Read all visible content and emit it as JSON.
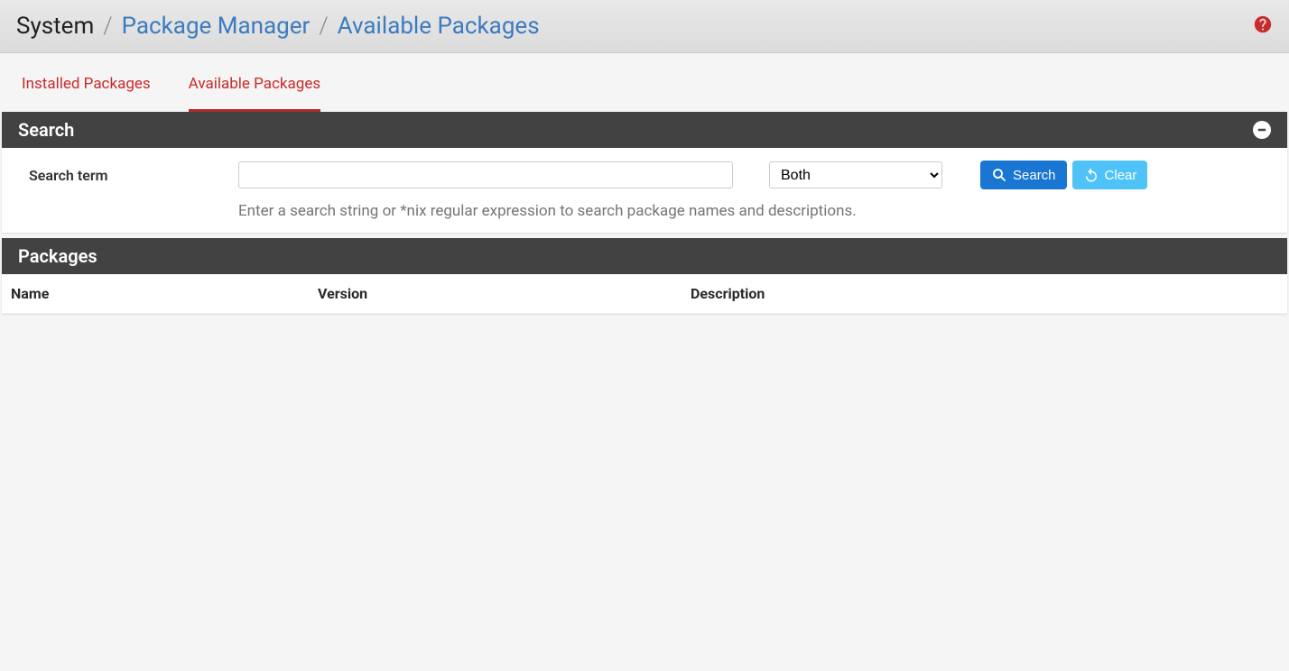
{
  "breadcrumb": {
    "root": "System",
    "link1": "Package Manager",
    "link2": "Available Packages"
  },
  "tabs": {
    "installed": "Installed Packages",
    "available": "Available Packages"
  },
  "searchPanel": {
    "title": "Search",
    "label": "Search term",
    "input_value": "",
    "select_selected": "Both",
    "options": [
      "Both"
    ],
    "search_button": "Search",
    "clear_button": "Clear",
    "help": "Enter a search string or *nix regular expression to search package names and descriptions."
  },
  "packagesPanel": {
    "title": "Packages",
    "columns": {
      "name": "Name",
      "version": "Version",
      "description": "Description"
    },
    "rows": []
  }
}
